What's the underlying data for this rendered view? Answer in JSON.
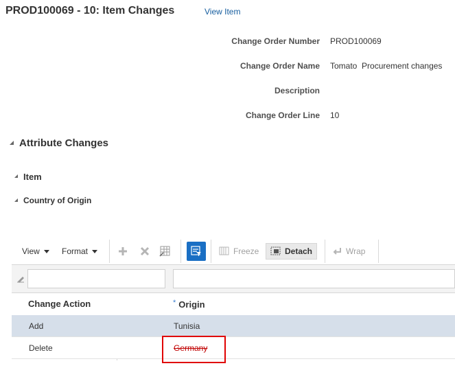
{
  "header": {
    "title": "PROD100069 - 10: Item Changes",
    "view_item_link": "View Item"
  },
  "form": {
    "change_order_number": {
      "label": "Change Order Number",
      "value": "PROD100069"
    },
    "change_order_name": {
      "label": "Change Order Name",
      "value": "Tomato  Procurement changes"
    },
    "description": {
      "label": "Description",
      "value": ""
    },
    "change_order_line": {
      "label": "Change Order Line",
      "value": "10"
    }
  },
  "sections": {
    "attribute_changes": "Attribute Changes",
    "item": "Item",
    "country_of_origin": "Country of Origin"
  },
  "toolbar": {
    "view_label": "View",
    "format_label": "Format",
    "freeze_label": "Freeze",
    "detach_label": "Detach",
    "wrap_label": "Wrap"
  },
  "table": {
    "columns": [
      {
        "label": "Change Action",
        "required": false
      },
      {
        "label": "Origin",
        "required": true,
        "required_marker": "*"
      }
    ],
    "rows": [
      {
        "change_action": "Add",
        "origin": "Tunisia",
        "selected": true,
        "origin_struck": false
      },
      {
        "change_action": "Delete",
        "origin": "Germany",
        "selected": false,
        "origin_struck": true
      }
    ]
  },
  "colors": {
    "link": "#145c9e",
    "selected_row": "#d6dfea",
    "deleted_text": "#c00000",
    "highlight_box": "#e00000",
    "toolbar_accent": "#1a6fc4"
  }
}
